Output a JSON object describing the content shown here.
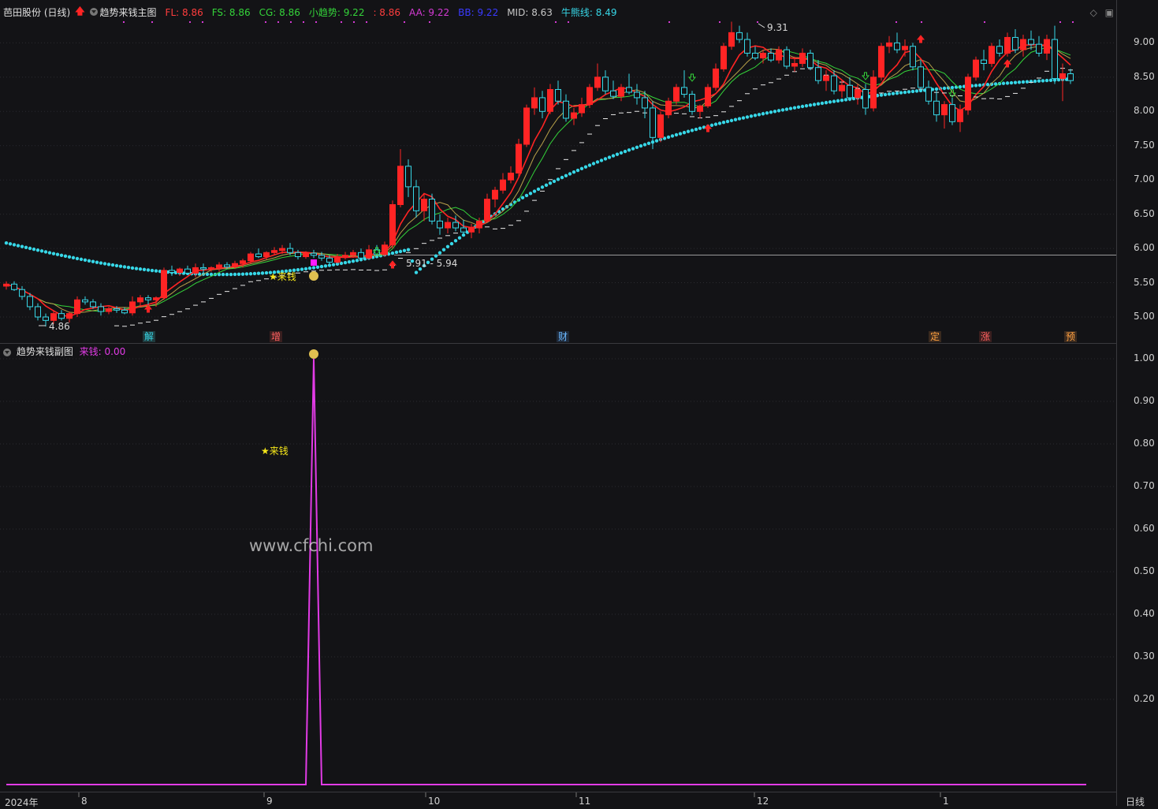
{
  "main": {
    "title": "芭田股份 (日线)",
    "indicator_name": "趋势来钱主图",
    "params": [
      {
        "label": "FL: 8.86",
        "color": "#ff3d3d"
      },
      {
        "label": "FS: 8.86",
        "color": "#34d43a"
      },
      {
        "label": "CG: 8.86",
        "color": "#34d43a"
      },
      {
        "label": "小趋势: 9.22",
        "color": "#34d43a"
      },
      {
        "label": ": 8.86",
        "color": "#ff3d3d"
      },
      {
        "label": "AA: 9.22",
        "color": "#d43ad4"
      },
      {
        "label": "BB: 9.22",
        "color": "#3a3aff"
      },
      {
        "label": "MID: 8.63",
        "color": "#c8c8c8"
      },
      {
        "label": "牛熊线: 8.49",
        "color": "#37d7e7"
      }
    ],
    "y_ticks": [
      "9.00",
      "8.50",
      "8.00",
      "7.50",
      "7.00",
      "6.50",
      "6.00",
      "5.50",
      "5.00"
    ],
    "annotations": {
      "high": "9.31",
      "low": "4.86",
      "range": "5.91 - 5.94",
      "signal": "来钱"
    },
    "events": [
      {
        "label": "解",
        "color": "#37d7e7",
        "bg": "#1f3a3d"
      },
      {
        "label": "增",
        "color": "#ff6060",
        "bg": "#3a1f1f"
      },
      {
        "label": "财",
        "color": "#6ab8ff",
        "bg": "#1f2a3a"
      },
      {
        "label": "定",
        "color": "#ffa040",
        "bg": "#3a2a1f"
      },
      {
        "label": "涨",
        "color": "#ff6060",
        "bg": "#3a1f1f"
      },
      {
        "label": "预",
        "color": "#ffa040",
        "bg": "#3a2a1f"
      }
    ]
  },
  "sub": {
    "indicator_name": "趋势来钱副图",
    "value_label": "来钱: 0.00",
    "signal": "★来钱",
    "y_ticks": [
      "1.00",
      "0.90",
      "0.80",
      "0.70",
      "0.60",
      "0.50",
      "0.40",
      "0.30",
      "0.20"
    ]
  },
  "x_axis": {
    "labels": [
      "2024年",
      "8",
      "9",
      "10",
      "11",
      "12",
      "1"
    ],
    "period": "日线"
  },
  "watermark": "www.cfchi.com",
  "colors": {
    "up": "#ff2424",
    "down": "#37d7e7",
    "bull_bear": "#37d7e7",
    "signal": "#e23be6"
  },
  "chart_data": {
    "type": "candlestick",
    "ylim": [
      4.8,
      9.4
    ],
    "candles_ohlc": [
      [
        5.45,
        5.52,
        5.4,
        5.48
      ],
      [
        5.48,
        5.52,
        5.38,
        5.4
      ],
      [
        5.4,
        5.45,
        5.25,
        5.3
      ],
      [
        5.3,
        5.35,
        5.1,
        5.15
      ],
      [
        5.15,
        5.2,
        4.95,
        5.0
      ],
      [
        5.0,
        5.05,
        4.86,
        4.95
      ],
      [
        4.95,
        5.1,
        4.9,
        5.05
      ],
      [
        5.05,
        5.1,
        4.95,
        4.98
      ],
      [
        4.98,
        5.08,
        4.92,
        5.05
      ],
      [
        5.05,
        5.3,
        5.0,
        5.25
      ],
      [
        5.25,
        5.3,
        5.18,
        5.22
      ],
      [
        5.22,
        5.26,
        5.12,
        5.15
      ],
      [
        5.15,
        5.2,
        5.02,
        5.08
      ],
      [
        5.08,
        5.15,
        5.04,
        5.12
      ],
      [
        5.12,
        5.16,
        5.06,
        5.1
      ],
      [
        5.1,
        5.14,
        5.04,
        5.06
      ],
      [
        5.06,
        5.3,
        5.02,
        5.22
      ],
      [
        5.22,
        5.32,
        5.15,
        5.28
      ],
      [
        5.28,
        5.32,
        5.18,
        5.25
      ],
      [
        5.25,
        5.3,
        5.15,
        5.28
      ],
      [
        5.28,
        5.72,
        5.25,
        5.68
      ],
      [
        5.68,
        5.75,
        5.6,
        5.65
      ],
      [
        5.65,
        5.72,
        5.6,
        5.7
      ],
      [
        5.7,
        5.75,
        5.62,
        5.64
      ],
      [
        5.64,
        5.78,
        5.58,
        5.72
      ],
      [
        5.72,
        5.78,
        5.65,
        5.7
      ],
      [
        5.7,
        5.74,
        5.66,
        5.72
      ],
      [
        5.72,
        5.8,
        5.66,
        5.76
      ],
      [
        5.76,
        5.8,
        5.7,
        5.73
      ],
      [
        5.73,
        5.82,
        5.7,
        5.78
      ],
      [
        5.78,
        5.85,
        5.72,
        5.82
      ],
      [
        5.82,
        5.95,
        5.78,
        5.92
      ],
      [
        5.92,
        6.0,
        5.86,
        5.88
      ],
      [
        5.88,
        5.96,
        5.84,
        5.94
      ],
      [
        5.94,
        6.02,
        5.9,
        5.97
      ],
      [
        5.97,
        6.05,
        5.92,
        6.0
      ],
      [
        6.0,
        6.08,
        5.9,
        5.94
      ],
      [
        5.94,
        5.98,
        5.84,
        5.88
      ],
      [
        5.88,
        5.96,
        5.85,
        5.93
      ],
      [
        5.93,
        5.98,
        5.86,
        5.9
      ],
      [
        5.9,
        5.95,
        5.82,
        5.86
      ],
      [
        5.86,
        5.9,
        5.76,
        5.8
      ],
      [
        5.8,
        5.92,
        5.78,
        5.88
      ],
      [
        5.88,
        5.95,
        5.84,
        5.9
      ],
      [
        5.9,
        5.98,
        5.86,
        5.94
      ],
      [
        5.94,
        6.0,
        5.84,
        5.86
      ],
      [
        5.86,
        6.05,
        5.84,
        5.98
      ],
      [
        5.98,
        6.05,
        5.88,
        5.91
      ],
      [
        5.91,
        6.1,
        5.88,
        6.05
      ],
      [
        6.05,
        6.7,
        6.0,
        6.64
      ],
      [
        6.64,
        7.45,
        6.6,
        7.2
      ],
      [
        7.2,
        7.3,
        6.75,
        6.9
      ],
      [
        6.9,
        7.0,
        6.45,
        6.55
      ],
      [
        6.55,
        6.8,
        6.4,
        6.72
      ],
      [
        6.72,
        6.8,
        6.35,
        6.4
      ],
      [
        6.4,
        6.5,
        6.2,
        6.3
      ],
      [
        6.3,
        6.45,
        6.22,
        6.38
      ],
      [
        6.38,
        6.48,
        6.25,
        6.3
      ],
      [
        6.3,
        6.42,
        6.18,
        6.24
      ],
      [
        6.24,
        6.36,
        6.15,
        6.3
      ],
      [
        6.3,
        6.45,
        6.22,
        6.4
      ],
      [
        6.4,
        6.8,
        6.38,
        6.72
      ],
      [
        6.72,
        6.9,
        6.6,
        6.85
      ],
      [
        6.85,
        7.1,
        6.8,
        7.0
      ],
      [
        7.0,
        7.2,
        6.95,
        7.1
      ],
      [
        7.1,
        7.6,
        7.05,
        7.52
      ],
      [
        7.52,
        8.1,
        7.48,
        8.05
      ],
      [
        8.05,
        8.35,
        7.95,
        8.2
      ],
      [
        8.2,
        8.3,
        7.9,
        8.0
      ],
      [
        8.0,
        8.4,
        7.96,
        8.32
      ],
      [
        8.32,
        8.45,
        8.1,
        8.15
      ],
      [
        8.15,
        8.25,
        7.85,
        7.9
      ],
      [
        7.9,
        8.05,
        7.8,
        7.98
      ],
      [
        7.98,
        8.2,
        7.92,
        8.1
      ],
      [
        8.1,
        8.4,
        8.05,
        8.35
      ],
      [
        8.35,
        8.7,
        8.3,
        8.5
      ],
      [
        8.5,
        8.6,
        8.25,
        8.3
      ],
      [
        8.3,
        8.45,
        8.18,
        8.22
      ],
      [
        8.22,
        8.4,
        8.15,
        8.35
      ],
      [
        8.35,
        8.55,
        8.25,
        8.28
      ],
      [
        8.28,
        8.4,
        8.1,
        8.2
      ],
      [
        8.2,
        8.3,
        7.9,
        8.05
      ],
      [
        8.05,
        8.15,
        7.45,
        7.62
      ],
      [
        7.62,
        8.0,
        7.55,
        7.95
      ],
      [
        7.95,
        8.2,
        7.9,
        8.15
      ],
      [
        8.15,
        8.4,
        8.1,
        8.35
      ],
      [
        8.35,
        8.6,
        8.2,
        8.25
      ],
      [
        8.25,
        8.3,
        7.95,
        8.0
      ],
      [
        8.0,
        8.1,
        7.9,
        8.08
      ],
      [
        8.08,
        8.4,
        8.05,
        8.35
      ],
      [
        8.35,
        8.7,
        8.3,
        8.62
      ],
      [
        8.62,
        9.0,
        8.58,
        8.95
      ],
      [
        8.95,
        9.31,
        8.9,
        9.15
      ],
      [
        9.15,
        9.25,
        9.0,
        9.05
      ],
      [
        9.05,
        9.15,
        8.8,
        8.85
      ],
      [
        8.85,
        8.95,
        8.75,
        8.78
      ],
      [
        8.78,
        8.9,
        8.7,
        8.85
      ],
      [
        8.85,
        8.92,
        8.72,
        8.75
      ],
      [
        8.75,
        8.95,
        8.7,
        8.9
      ],
      [
        8.9,
        8.95,
        8.62,
        8.66
      ],
      [
        8.66,
        8.8,
        8.58,
        8.7
      ],
      [
        8.7,
        8.92,
        8.65,
        8.85
      ],
      [
        8.85,
        8.9,
        8.6,
        8.64
      ],
      [
        8.64,
        8.75,
        8.4,
        8.45
      ],
      [
        8.45,
        8.6,
        8.3,
        8.52
      ],
      [
        8.52,
        8.6,
        8.25,
        8.3
      ],
      [
        8.3,
        8.45,
        8.2,
        8.38
      ],
      [
        8.38,
        8.5,
        8.15,
        8.2
      ],
      [
        8.2,
        8.4,
        8.1,
        8.32
      ],
      [
        8.32,
        8.4,
        7.95,
        8.05
      ],
      [
        8.05,
        8.6,
        8.0,
        8.5
      ],
      [
        8.5,
        9.0,
        8.45,
        8.95
      ],
      [
        8.95,
        9.1,
        8.85,
        9.0
      ],
      [
        9.0,
        9.15,
        8.85,
        8.9
      ],
      [
        8.9,
        9.05,
        8.8,
        8.95
      ],
      [
        8.95,
        9.0,
        8.6,
        8.65
      ],
      [
        8.65,
        8.75,
        8.3,
        8.35
      ],
      [
        8.35,
        8.45,
        8.1,
        8.15
      ],
      [
        8.15,
        8.3,
        7.85,
        7.95
      ],
      [
        7.95,
        8.15,
        7.75,
        8.1
      ],
      [
        8.1,
        8.2,
        7.8,
        7.85
      ],
      [
        7.85,
        8.1,
        7.7,
        8.02
      ],
      [
        8.02,
        8.55,
        7.95,
        8.5
      ],
      [
        8.5,
        8.8,
        8.45,
        8.75
      ],
      [
        8.75,
        8.9,
        8.6,
        8.7
      ],
      [
        8.7,
        9.0,
        8.65,
        8.95
      ],
      [
        8.95,
        9.05,
        8.8,
        8.85
      ],
      [
        8.85,
        9.15,
        8.8,
        9.08
      ],
      [
        9.08,
        9.2,
        8.85,
        8.9
      ],
      [
        8.9,
        9.12,
        8.8,
        9.05
      ],
      [
        9.05,
        9.18,
        8.9,
        8.98
      ],
      [
        8.98,
        9.1,
        8.8,
        8.85
      ],
      [
        8.85,
        9.12,
        8.75,
        9.05
      ],
      [
        9.05,
        9.25,
        8.4,
        8.48
      ],
      [
        8.48,
        8.7,
        8.15,
        8.55
      ],
      [
        8.55,
        8.62,
        8.4,
        8.45
      ]
    ],
    "sub_series": {
      "name": "来钱",
      "peak_index": 39,
      "peak_value": 1.0
    }
  }
}
